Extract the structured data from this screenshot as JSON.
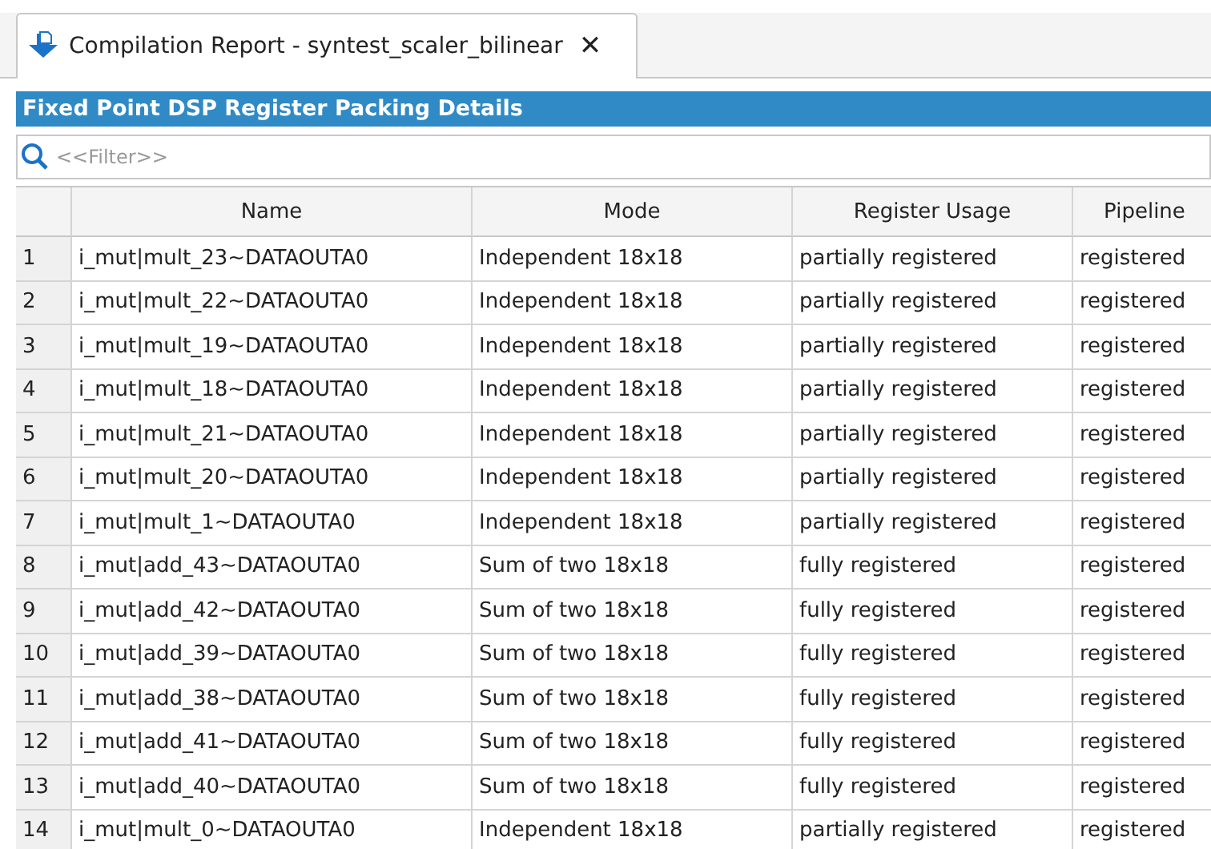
{
  "tab": {
    "title": "Compilation Report - syntest_scaler_bilinear",
    "close": "✕"
  },
  "panel": {
    "title": "Fixed Point DSP Register Packing Details"
  },
  "filter": {
    "placeholder": "<<Filter>>"
  },
  "table": {
    "columns": [
      "Name",
      "Mode",
      "Register Usage",
      "Pipeline"
    ],
    "rows": [
      {
        "index": "1",
        "cells": [
          "i_mut|mult_23~DATAOUTA0",
          "Independent 18x18",
          "partially registered",
          "registered"
        ]
      },
      {
        "index": "2",
        "cells": [
          "i_mut|mult_22~DATAOUTA0",
          "Independent 18x18",
          "partially registered",
          "registered"
        ]
      },
      {
        "index": "3",
        "cells": [
          "i_mut|mult_19~DATAOUTA0",
          "Independent 18x18",
          "partially registered",
          "registered"
        ]
      },
      {
        "index": "4",
        "cells": [
          "i_mut|mult_18~DATAOUTA0",
          "Independent 18x18",
          "partially registered",
          "registered"
        ]
      },
      {
        "index": "5",
        "cells": [
          "i_mut|mult_21~DATAOUTA0",
          "Independent 18x18",
          "partially registered",
          "registered"
        ]
      },
      {
        "index": "6",
        "cells": [
          "i_mut|mult_20~DATAOUTA0",
          "Independent 18x18",
          "partially registered",
          "registered"
        ]
      },
      {
        "index": "7",
        "cells": [
          "i_mut|mult_1~DATAOUTA0",
          "Independent 18x18",
          "partially registered",
          "registered"
        ]
      },
      {
        "index": "8",
        "cells": [
          "i_mut|add_43~DATAOUTA0",
          "Sum of two 18x18",
          "fully registered",
          "registered"
        ]
      },
      {
        "index": "9",
        "cells": [
          "i_mut|add_42~DATAOUTA0",
          "Sum of two 18x18",
          "fully registered",
          "registered"
        ]
      },
      {
        "index": "10",
        "cells": [
          "i_mut|add_39~DATAOUTA0",
          "Sum of two 18x18",
          "fully registered",
          "registered"
        ]
      },
      {
        "index": "11",
        "cells": [
          "i_mut|add_38~DATAOUTA0",
          "Sum of two 18x18",
          "fully registered",
          "registered"
        ]
      },
      {
        "index": "12",
        "cells": [
          "i_mut|add_41~DATAOUTA0",
          "Sum of two 18x18",
          "fully registered",
          "registered"
        ]
      },
      {
        "index": "13",
        "cells": [
          "i_mut|add_40~DATAOUTA0",
          "Sum of two 18x18",
          "fully registered",
          "registered"
        ]
      },
      {
        "index": "14",
        "cells": [
          "i_mut|mult_0~DATAOUTA0",
          "Independent 18x18",
          "partially registered",
          "registered"
        ]
      }
    ]
  }
}
